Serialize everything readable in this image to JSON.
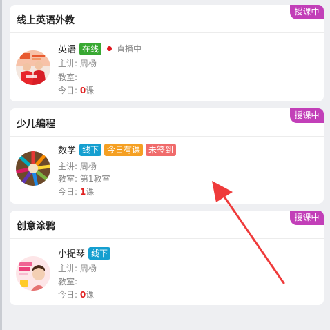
{
  "cards": [
    {
      "title": "线上英语外教",
      "status": "授课中",
      "subject": "英语",
      "tags": [
        {
          "text": "在线",
          "color": "#38a832"
        }
      ],
      "live": "直播中",
      "teacher": "主讲: 周杨",
      "room": "教室:",
      "today_prefix": "今日: ",
      "today_count": "0",
      "today_suffix": "课",
      "avatar_icon": "english-class-photo"
    },
    {
      "title": "少儿编程",
      "status": "授课中",
      "subject": "数学",
      "tags": [
        {
          "text": "线下",
          "color": "#159fd0"
        },
        {
          "text": "今日有课",
          "color": "#f5a023"
        },
        {
          "text": "未签到",
          "color": "#f06b6b"
        }
      ],
      "teacher": "主讲: 周杨",
      "room": "教室: 第1教室",
      "today_prefix": "今日: ",
      "today_count": "1",
      "today_suffix": "课",
      "avatar_icon": "colored-pencils-image"
    },
    {
      "title": "创意涂鸦",
      "status": "授课中",
      "subject": "小提琴",
      "tags": [
        {
          "text": "线下",
          "color": "#159fd0"
        }
      ],
      "teacher": "主讲: 周杨",
      "room": "教室:",
      "today_prefix": "今日: ",
      "today_count": "0",
      "today_suffix": "课",
      "avatar_icon": "violin-class-poster"
    }
  ],
  "annotation": {
    "type": "red-arrow",
    "color": "#ef3b3b"
  }
}
